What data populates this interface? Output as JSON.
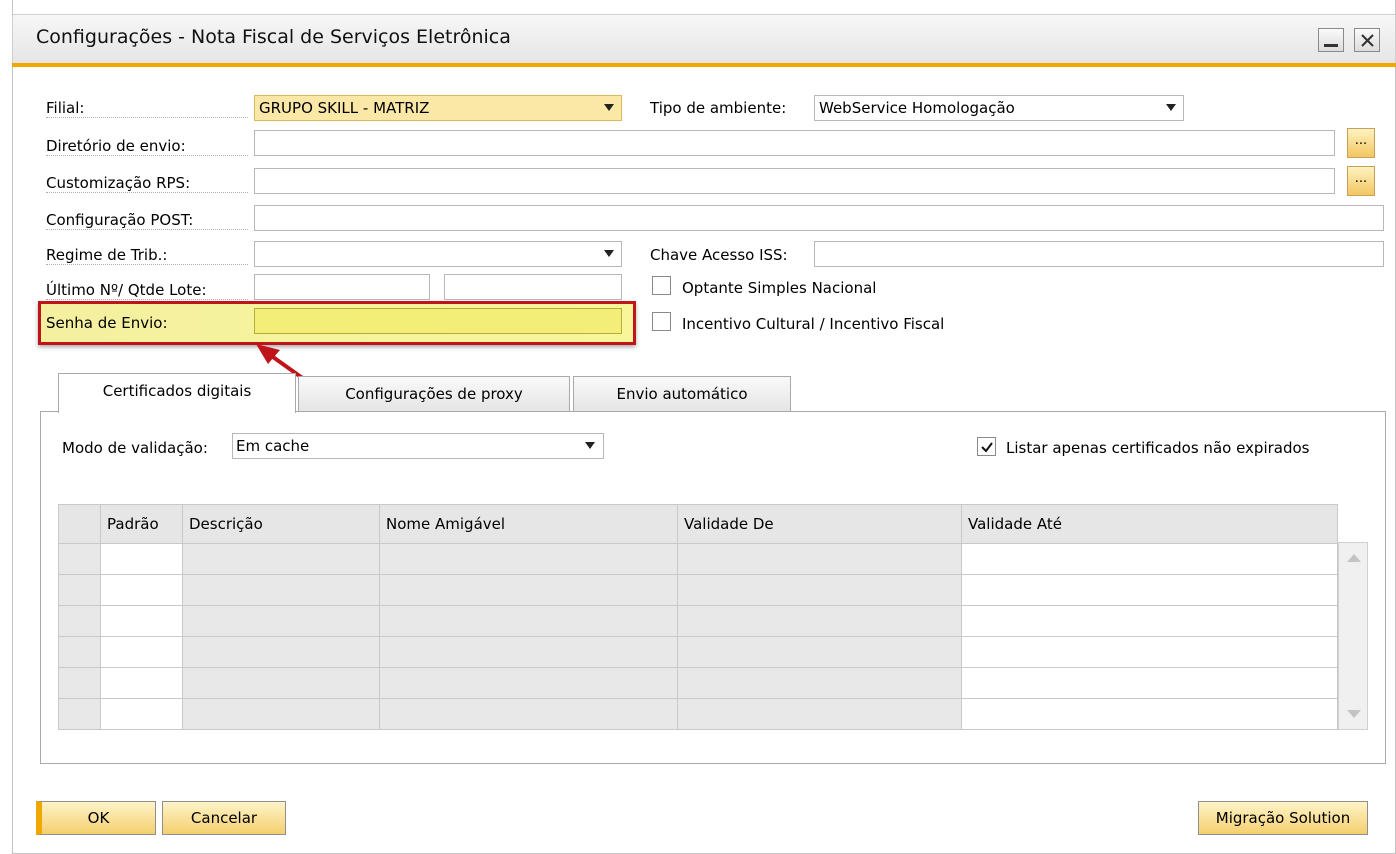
{
  "window": {
    "title": "Configurações - Nota Fiscal de Serviços Eletrônica"
  },
  "form": {
    "filial_label": "Filial:",
    "filial_value": "GRUPO SKILL - MATRIZ",
    "tipo_ambiente_label": "Tipo de ambiente:",
    "tipo_ambiente_value": "WebService Homologação",
    "diretorio_label": "Diretório de envio:",
    "diretorio_value": "",
    "customizacao_label": "Customização RPS:",
    "customizacao_value": "",
    "configuracao_post_label": "Configuração POST:",
    "configuracao_post_value": "",
    "regime_label": "Regime de Trib.:",
    "regime_value": "",
    "chave_label": "Chave Acesso ISS:",
    "chave_value": "",
    "ultimo_label": "Último Nº/ Qtde  Lote:",
    "ultimo_value": "",
    "qtde_value": "",
    "optante_label": "Optante Simples Nacional",
    "optante_checked": false,
    "senha_label": "Senha de Envio:",
    "senha_value": "",
    "incentivo_label": "Incentivo Cultural / Incentivo Fiscal",
    "incentivo_checked": false,
    "browse_label": "..."
  },
  "tabs": [
    {
      "label": "Certificados digitais",
      "active": true
    },
    {
      "label": "Configurações de proxy",
      "active": false
    },
    {
      "label": "Envio automático",
      "active": false
    }
  ],
  "cert_tab": {
    "modo_label": "Modo de validação:",
    "modo_value": "Em cache",
    "listar_label": "Listar apenas certificados não expirados",
    "listar_checked": true,
    "columns": [
      "Padrão",
      "Descrição",
      "Nome Amigável",
      "Validade De",
      "Validade Até"
    ],
    "row_count": 6
  },
  "buttons": {
    "ok": "OK",
    "cancel": "Cancelar",
    "migracao": "Migração Solution"
  },
  "colors": {
    "accent_orange": "#f0a800",
    "highlight_yellow": "#f8f59a",
    "annotation_red": "#c0141b"
  }
}
